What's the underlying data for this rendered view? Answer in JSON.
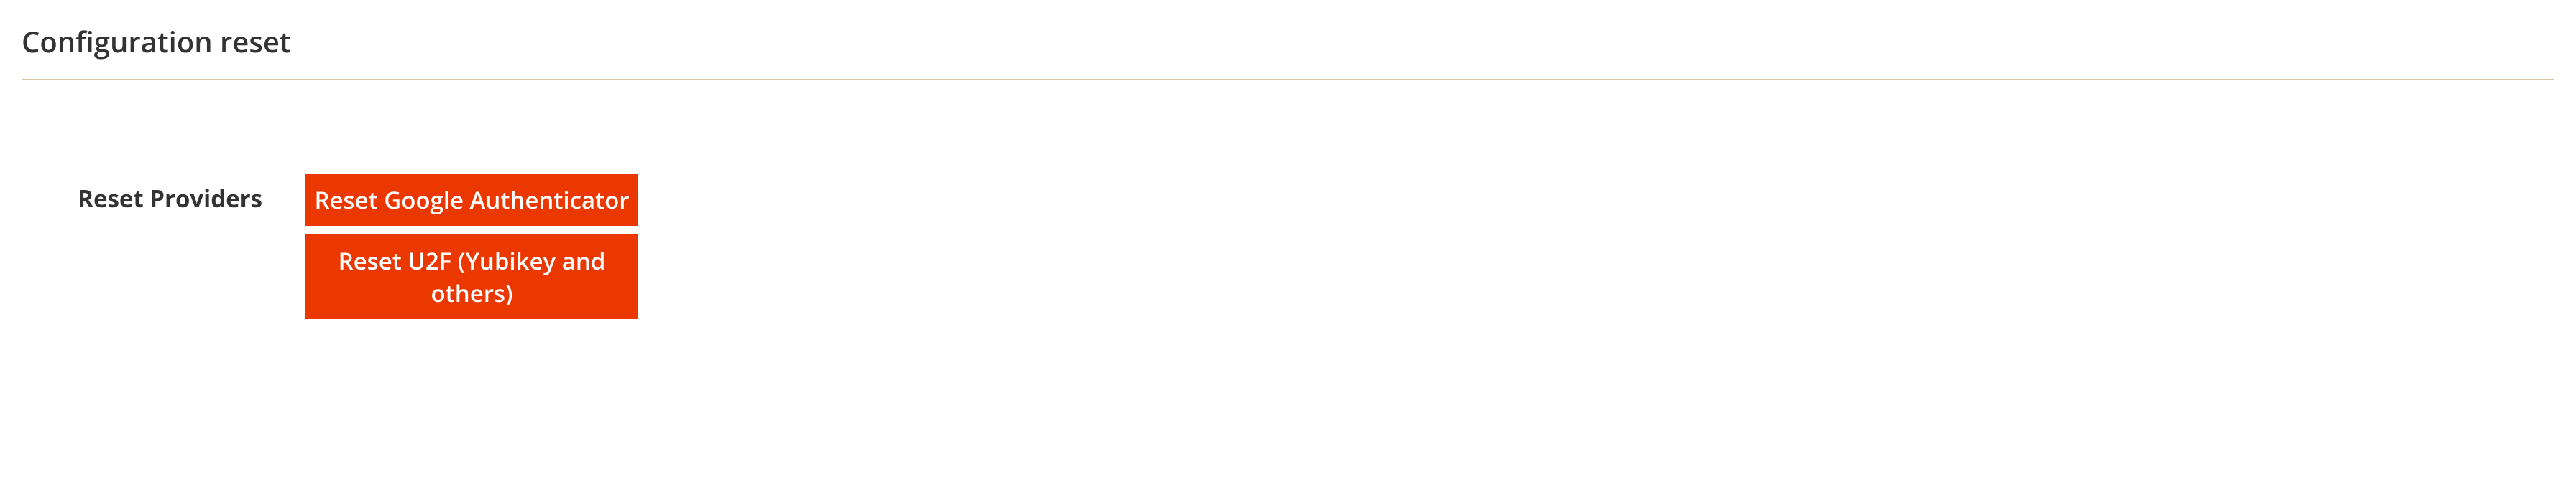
{
  "section": {
    "title": "Configuration reset",
    "form": {
      "label": "Reset Providers",
      "buttons": [
        {
          "label": "Reset Google Authenticator"
        },
        {
          "label": "Reset U2F (Yubikey and others)"
        }
      ]
    }
  }
}
